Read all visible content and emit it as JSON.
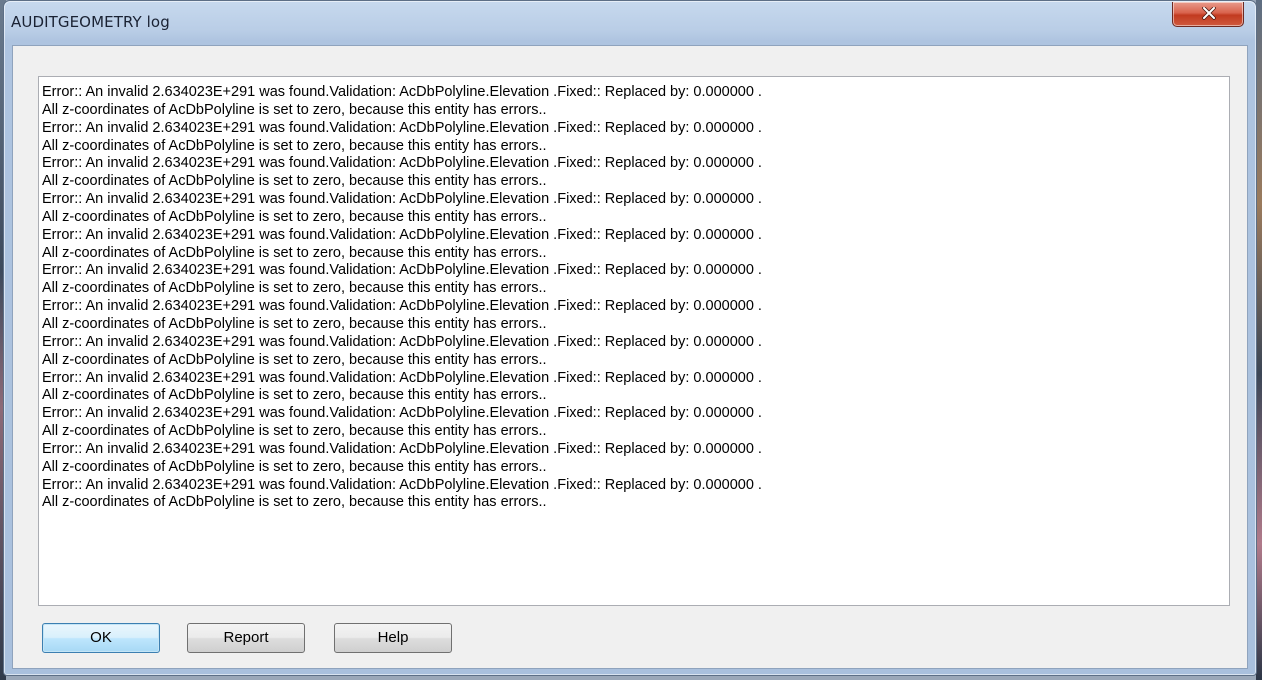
{
  "window": {
    "title": "AUDITGEOMETRY log"
  },
  "log": {
    "lines": [
      "Error:: An invalid 2.634023E+291 was found.Validation: AcDbPolyline.Elevation .Fixed:: Replaced by: 0.000000 .",
      "All z-coordinates of AcDbPolyline is set to zero, because this entity has errors..",
      "Error:: An invalid 2.634023E+291 was found.Validation: AcDbPolyline.Elevation .Fixed:: Replaced by: 0.000000 .",
      "All z-coordinates of AcDbPolyline is set to zero, because this entity has errors..",
      "Error:: An invalid 2.634023E+291 was found.Validation: AcDbPolyline.Elevation .Fixed:: Replaced by: 0.000000 .",
      "All z-coordinates of AcDbPolyline is set to zero, because this entity has errors..",
      "Error:: An invalid 2.634023E+291 was found.Validation: AcDbPolyline.Elevation .Fixed:: Replaced by: 0.000000 .",
      "All z-coordinates of AcDbPolyline is set to zero, because this entity has errors..",
      "Error:: An invalid 2.634023E+291 was found.Validation: AcDbPolyline.Elevation .Fixed:: Replaced by: 0.000000 .",
      "All z-coordinates of AcDbPolyline is set to zero, because this entity has errors..",
      "Error:: An invalid 2.634023E+291 was found.Validation: AcDbPolyline.Elevation .Fixed:: Replaced by: 0.000000 .",
      "All z-coordinates of AcDbPolyline is set to zero, because this entity has errors..",
      "Error:: An invalid 2.634023E+291 was found.Validation: AcDbPolyline.Elevation .Fixed:: Replaced by: 0.000000 .",
      "All z-coordinates of AcDbPolyline is set to zero, because this entity has errors..",
      "Error:: An invalid 2.634023E+291 was found.Validation: AcDbPolyline.Elevation .Fixed:: Replaced by: 0.000000 .",
      "All z-coordinates of AcDbPolyline is set to zero, because this entity has errors..",
      "Error:: An invalid 2.634023E+291 was found.Validation: AcDbPolyline.Elevation .Fixed:: Replaced by: 0.000000 .",
      "All z-coordinates of AcDbPolyline is set to zero, because this entity has errors..",
      "Error:: An invalid 2.634023E+291 was found.Validation: AcDbPolyline.Elevation .Fixed:: Replaced by: 0.000000 .",
      "All z-coordinates of AcDbPolyline is set to zero, because this entity has errors..",
      "Error:: An invalid 2.634023E+291 was found.Validation: AcDbPolyline.Elevation .Fixed:: Replaced by: 0.000000 .",
      "All z-coordinates of AcDbPolyline is set to zero, because this entity has errors..",
      "Error:: An invalid 2.634023E+291 was found.Validation: AcDbPolyline.Elevation .Fixed:: Replaced by: 0.000000 .",
      "All z-coordinates of AcDbPolyline is set to zero, because this entity has errors.."
    ]
  },
  "buttons": {
    "ok": "OK",
    "report": "Report",
    "help": "Help"
  },
  "icons": {
    "close": "close-icon"
  },
  "colors": {
    "close_button": "#c7432b",
    "default_button_border": "#3c7fb1"
  }
}
